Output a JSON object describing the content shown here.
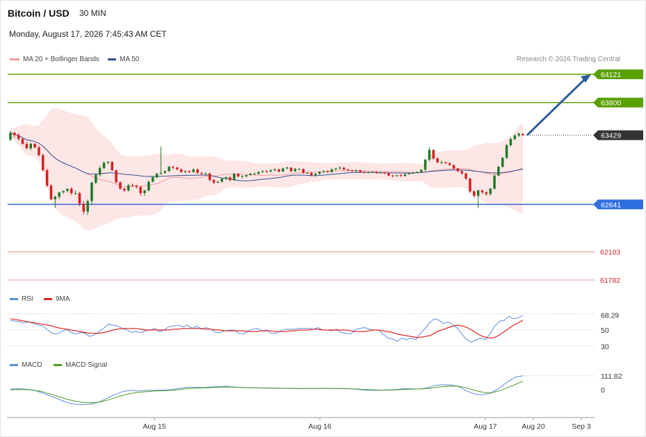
{
  "header": {
    "title": "Bitcoin / USD",
    "timeframe": "30 MIN",
    "datetime": "Monday, August 17, 2026 7:45:43 AM CET"
  },
  "legend": {
    "ma20": "MA 20 + Bollinger Bands",
    "ma50": "MA 50",
    "credit": "Research © 2026 Trading Central"
  },
  "colors": {
    "resistance": "#5aa000",
    "support_line": "#2f6fe0",
    "red_level": "#e06a6a",
    "current": "#333333",
    "arrow": "#2b5a9a",
    "bull": "#1f7a25",
    "bear": "#d42020",
    "band": "#fde6e6",
    "ma20": "#f39b9b",
    "ma50": "#2d4f8f",
    "rsi": "#5b8de0",
    "rsi_ma": "#e02020",
    "macd": "#5b8de0",
    "macd_signal": "#4a9a20"
  },
  "chart_data": [
    {
      "type": "candlestick",
      "name": "price",
      "ylim": [
        61650,
        64250
      ],
      "x_ticks": [
        "Aug 15",
        "Aug 16",
        "Aug 17",
        "Aug 20",
        "Sep 3"
      ],
      "levels": [
        {
          "value": 64121,
          "label": "64121",
          "kind": "resistance"
        },
        {
          "value": 63800,
          "label": "63800",
          "kind": "resistance"
        },
        {
          "value": 63429,
          "label": "63429",
          "kind": "current"
        },
        {
          "value": 62641,
          "label": "62641",
          "kind": "support"
        },
        {
          "value": 62103,
          "label": "62103",
          "kind": "red"
        },
        {
          "value": 61782,
          "label": "61782",
          "kind": "red"
        }
      ],
      "close": [
        63455,
        63430,
        63385,
        63330,
        63280,
        63330,
        63290,
        63200,
        63030,
        62855,
        62700,
        62730,
        62780,
        62795,
        62820,
        62770,
        62770,
        62650,
        62560,
        62680,
        62890,
        62980,
        63055,
        63115,
        63125,
        63030,
        62895,
        62820,
        62800,
        62860,
        62855,
        62840,
        62770,
        62800,
        62900,
        62950,
        62990,
        63000,
        63020,
        63070,
        63060,
        63040,
        63010,
        63020,
        63010,
        63040,
        63000,
        62990,
        62995,
        62920,
        62890,
        62900,
        62935,
        62950,
        62920,
        62990,
        62960,
        62960,
        62975,
        62990,
        62990,
        63010,
        63020,
        63015,
        63030,
        63040,
        63015,
        63050,
        63060,
        63020,
        63045,
        63045,
        63000,
        63000,
        62975,
        62990,
        63010,
        63020,
        63010,
        63040,
        63050,
        63060,
        63040,
        63030,
        63020,
        63030,
        63010,
        63005,
        63010,
        63010,
        63000,
        63005,
        62995,
        62970,
        62965,
        62975,
        62965,
        62985,
        62995,
        63000,
        63010,
        63035,
        63150,
        63260,
        63165,
        63120,
        63120,
        63110,
        63090,
        63050,
        63020,
        62995,
        62935,
        62790,
        62740,
        62800,
        62780,
        62760,
        62820,
        62970,
        63070,
        63170,
        63315,
        63385,
        63425,
        63445,
        63429
      ],
      "open": [
        63380,
        63455,
        63430,
        63385,
        63330,
        63280,
        63330,
        63290,
        63200,
        63030,
        62855,
        62700,
        62730,
        62780,
        62795,
        62820,
        62770,
        62770,
        62650,
        62560,
        62680,
        62890,
        62980,
        63055,
        63115,
        63125,
        63030,
        62895,
        62820,
        62800,
        62860,
        62855,
        62840,
        62770,
        62800,
        62900,
        62950,
        62990,
        63000,
        63020,
        63070,
        63060,
        63040,
        63010,
        63020,
        63010,
        63040,
        63000,
        62990,
        62995,
        62920,
        62890,
        62900,
        62935,
        62950,
        62920,
        62990,
        62960,
        62960,
        62975,
        62990,
        62990,
        63010,
        63020,
        63015,
        63030,
        63040,
        63015,
        63050,
        63060,
        63020,
        63045,
        63045,
        63000,
        63000,
        62975,
        62990,
        63010,
        63020,
        63010,
        63040,
        63050,
        63060,
        63040,
        63030,
        63020,
        63030,
        63010,
        63005,
        63010,
        63010,
        63000,
        63005,
        62995,
        62970,
        62965,
        62975,
        62965,
        62985,
        62995,
        63000,
        63010,
        63035,
        63150,
        63260,
        63165,
        63120,
        63120,
        63110,
        63090,
        63050,
        63020,
        62995,
        62935,
        62790,
        62740,
        62800,
        62780,
        62760,
        62820,
        62970,
        63070,
        63170,
        63315,
        63385,
        63425,
        63445
      ],
      "high": [
        63480,
        63470,
        63450,
        63400,
        63350,
        63345,
        63340,
        63310,
        63220,
        63050,
        62870,
        62740,
        62760,
        62800,
        62820,
        62835,
        62800,
        62785,
        62680,
        62700,
        62900,
        62995,
        63080,
        63130,
        63135,
        63130,
        63040,
        62900,
        62830,
        62875,
        62880,
        62860,
        62850,
        62810,
        62910,
        62960,
        63000,
        63300,
        63030,
        63080,
        63080,
        63070,
        63050,
        63030,
        63030,
        63050,
        63050,
        63010,
        63005,
        63000,
        62930,
        62910,
        62940,
        62960,
        62960,
        63000,
        63000,
        62975,
        62980,
        63000,
        63005,
        63020,
        63030,
        63030,
        63040,
        63050,
        63045,
        63060,
        63070,
        63065,
        63055,
        63055,
        63050,
        63010,
        63010,
        63000,
        63020,
        63030,
        63030,
        63050,
        63060,
        63075,
        63065,
        63045,
        63035,
        63040,
        63035,
        63020,
        63015,
        63020,
        63020,
        63010,
        63010,
        63005,
        62980,
        62975,
        62985,
        62990,
        63000,
        63010,
        63020,
        63040,
        63160,
        63290,
        63270,
        63175,
        63140,
        63130,
        63120,
        63095,
        63060,
        63030,
        63000,
        62945,
        62800,
        62810,
        62810,
        62790,
        62830,
        62980,
        63080,
        63180,
        63330,
        63400,
        63440,
        63460,
        63450
      ],
      "low": [
        63360,
        63400,
        63370,
        63320,
        63270,
        63260,
        63280,
        63190,
        63020,
        62840,
        62690,
        62600,
        62700,
        62760,
        62780,
        62750,
        62750,
        62620,
        62530,
        62520,
        62640,
        62870,
        62960,
        63040,
        63100,
        63020,
        62880,
        62810,
        62780,
        62790,
        62840,
        62820,
        62740,
        62740,
        62790,
        62890,
        62940,
        62980,
        62990,
        63010,
        63040,
        63030,
        63000,
        63000,
        63000,
        63000,
        62990,
        62970,
        62975,
        62900,
        62870,
        62880,
        62890,
        62920,
        62900,
        62910,
        62950,
        62940,
        62950,
        62970,
        62975,
        62980,
        63000,
        63000,
        63010,
        63020,
        63005,
        63010,
        63040,
        63010,
        63010,
        63030,
        62990,
        62990,
        62960,
        62960,
        62980,
        63000,
        63000,
        63000,
        63030,
        63040,
        63030,
        63020,
        63010,
        63010,
        63000,
        62995,
        62995,
        63000,
        62990,
        62990,
        62985,
        62960,
        62950,
        62955,
        62955,
        62960,
        62980,
        62985,
        62995,
        63005,
        63020,
        63130,
        63150,
        63110,
        63100,
        63100,
        63080,
        63040,
        63010,
        62980,
        62920,
        62770,
        62720,
        62600,
        62760,
        62740,
        62740,
        62810,
        62960,
        63060,
        63160,
        63300,
        63370,
        63410,
        63420
      ]
    },
    {
      "type": "line",
      "name": "rsi",
      "ylim": [
        20,
        80
      ],
      "y_labels": [
        {
          "value": 68.29,
          "label": "68.29"
        },
        {
          "value": 50,
          "label": "50"
        },
        {
          "value": 30,
          "label": "30"
        }
      ],
      "legend": [
        "RSI",
        "9MA"
      ],
      "rsi": [
        62,
        61,
        60,
        59,
        60,
        58,
        56,
        55,
        50,
        46,
        45,
        48,
        51,
        47,
        45,
        47,
        46,
        42,
        44,
        48,
        52,
        57,
        56,
        55,
        52,
        50,
        47,
        48,
        47,
        49,
        50,
        52,
        48,
        50,
        54,
        55,
        56,
        54,
        56,
        52,
        55,
        51,
        53,
        51,
        47,
        47,
        49,
        50,
        50,
        46,
        45,
        49,
        51,
        52,
        49,
        50,
        46,
        46,
        49,
        51,
        51,
        51,
        52,
        52,
        52,
        51,
        53,
        50,
        50,
        49,
        51,
        47,
        46,
        45,
        50,
        52,
        53,
        51,
        50,
        50,
        45,
        40,
        39,
        36,
        40,
        38,
        40,
        38,
        46,
        52,
        59,
        64,
        62,
        58,
        60,
        56,
        52,
        44,
        38,
        35,
        38,
        40,
        38,
        46,
        55,
        61,
        62,
        67,
        64,
        65,
        68.29
      ],
      "ma": [
        64,
        63,
        62,
        61,
        60,
        59,
        58,
        57,
        56,
        55,
        53,
        52,
        51,
        50,
        49,
        48,
        47,
        46,
        46,
        46,
        47,
        48,
        50,
        51,
        52,
        52,
        52,
        52,
        51,
        50,
        50,
        50,
        50,
        50,
        50,
        51,
        51,
        52,
        52,
        52,
        52,
        52,
        51,
        51,
        50,
        50,
        49,
        49,
        49,
        49,
        49,
        48,
        48,
        48,
        49,
        49,
        49,
        48,
        48,
        48,
        49,
        49,
        50,
        50,
        50,
        51,
        51,
        50,
        50,
        50,
        50,
        50,
        50,
        49,
        48,
        48,
        48,
        49,
        50,
        50,
        49,
        48,
        47,
        45,
        44,
        43,
        42,
        41,
        41,
        42,
        43,
        46,
        49,
        51,
        53,
        55,
        56,
        55,
        53,
        50,
        46,
        43,
        41,
        40,
        41,
        44,
        48,
        52,
        56,
        59,
        62
      ],
      "x_end_index": 126
    },
    {
      "type": "line",
      "name": "macd",
      "y_labels": [
        {
          "value": 111.82,
          "label": "111.82"
        },
        {
          "value": 0,
          "label": "0"
        }
      ],
      "legend": [
        "MACD",
        "MACD Signal"
      ],
      "macd": [
        5,
        8,
        4,
        -5,
        -25,
        -50,
        -75,
        -100,
        -115,
        -120,
        -115,
        -100,
        -70,
        -40,
        -15,
        -5,
        -10,
        -5,
        -5,
        -3,
        0,
        10,
        20,
        20,
        18,
        22,
        25,
        28,
        22,
        18,
        15,
        15,
        12,
        13,
        12,
        10,
        8,
        10,
        10,
        12,
        10,
        10,
        9,
        6,
        -2,
        -5,
        -5,
        0,
        0,
        8,
        8,
        5,
        15,
        35,
        40,
        38,
        25,
        -10,
        -35,
        -40,
        -25,
        10,
        60,
        100,
        111.82
      ],
      "signal": [
        0,
        2,
        1,
        -4,
        -15,
        -35,
        -55,
        -75,
        -90,
        -100,
        -105,
        -100,
        -85,
        -65,
        -45,
        -30,
        -20,
        -15,
        -10,
        -8,
        -5,
        0,
        8,
        12,
        15,
        17,
        20,
        22,
        21,
        19,
        17,
        15,
        14,
        13,
        12,
        11,
        10,
        10,
        10,
        10,
        10,
        10,
        9,
        7,
        3,
        0,
        -2,
        -3,
        -2,
        2,
        5,
        6,
        10,
        18,
        25,
        30,
        28,
        15,
        -5,
        -20,
        -25,
        -10,
        15,
        40,
        70
      ]
    }
  ]
}
